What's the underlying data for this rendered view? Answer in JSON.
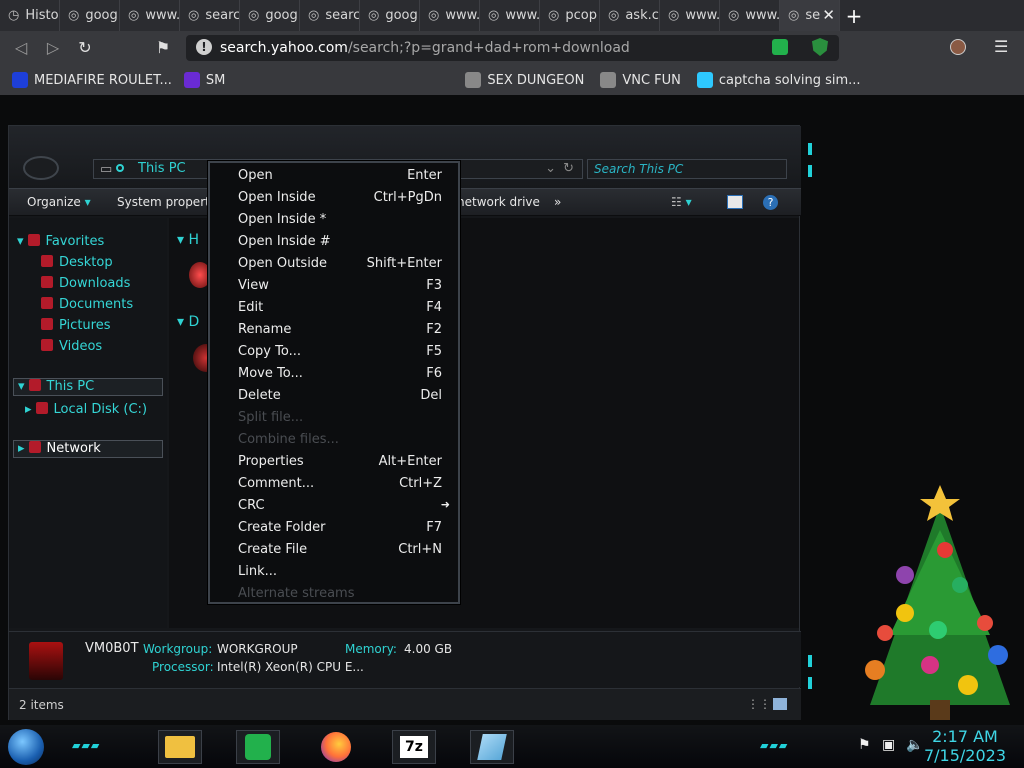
{
  "browser": {
    "tabs": [
      {
        "label": "Histo",
        "icon": "history-icon"
      },
      {
        "label": "goog",
        "icon": "globe-icon"
      },
      {
        "label": "www.",
        "icon": "globe-icon"
      },
      {
        "label": "searc",
        "icon": "globe-icon"
      },
      {
        "label": "goog",
        "icon": "globe-icon"
      },
      {
        "label": "searc",
        "icon": "globe-icon"
      },
      {
        "label": "goog",
        "icon": "globe-icon"
      },
      {
        "label": "www.",
        "icon": "globe-icon"
      },
      {
        "label": "www.",
        "icon": "globe-icon"
      },
      {
        "label": "pcop",
        "icon": "globe-icon"
      },
      {
        "label": "ask.c",
        "icon": "globe-icon"
      },
      {
        "label": "www.",
        "icon": "globe-icon"
      },
      {
        "label": "www.",
        "icon": "globe-icon"
      },
      {
        "label": "se",
        "icon": "globe-icon",
        "active": true
      }
    ],
    "new_tab": "+",
    "close_tab": "✕",
    "url_host": "search.yahoo.com",
    "url_path": "/search;?p=grand+dad+rom+download",
    "bookmarks": [
      {
        "label": "MEDIAFIRE ROULET...",
        "color": "#1e3fd8"
      },
      {
        "label": "SM",
        "color": "#6a2bd3"
      },
      {
        "label": "SEX DUNGEON",
        "color": "#888888"
      },
      {
        "label": "VNC FUN",
        "color": "#888888"
      },
      {
        "label": "captcha solving sim...",
        "color": "#2ec9ff"
      }
    ]
  },
  "explorer": {
    "address": "This PC",
    "search_placeholder": "Search This PC",
    "commands": {
      "organize": "Organize",
      "system_properties": "System properties",
      "map_network": "network drive",
      "more": "»"
    },
    "nav": {
      "favorites": "Favorites",
      "desktop": "Desktop",
      "downloads": "Downloads",
      "documents": "Documents",
      "pictures": "Pictures",
      "videos": "Videos",
      "this_pc": "This PC",
      "local_disk": "Local Disk (C:)",
      "network": "Network"
    },
    "content": {
      "group1_initial": "H",
      "group2_initial": "D"
    },
    "details": {
      "computer_name": "VM0B0T",
      "workgroup_label": "Workgroup:",
      "workgroup_value": "WORKGROUP",
      "memory_label": "Memory:",
      "memory_value": "4.00 GB",
      "processor_label": "Processor:",
      "processor_value": "Intel(R) Xeon(R) CPU E..."
    },
    "status": "2 items"
  },
  "context_menu": {
    "items": [
      {
        "label": "Open",
        "shortcut": "Enter",
        "enabled": true
      },
      {
        "label": "Open Inside",
        "shortcut": "Ctrl+PgDn",
        "enabled": true
      },
      {
        "label": "Open Inside *",
        "shortcut": "",
        "enabled": true
      },
      {
        "label": "Open Inside #",
        "shortcut": "",
        "enabled": true
      },
      {
        "label": "Open Outside",
        "shortcut": "Shift+Enter",
        "enabled": true
      },
      {
        "label": "View",
        "shortcut": "F3",
        "enabled": true
      },
      {
        "label": "Edit",
        "shortcut": "F4",
        "enabled": true
      },
      {
        "label": "Rename",
        "shortcut": "F2",
        "enabled": true
      },
      {
        "label": "Copy To...",
        "shortcut": "F5",
        "enabled": true
      },
      {
        "label": "Move To...",
        "shortcut": "F6",
        "enabled": true
      },
      {
        "label": "Delete",
        "shortcut": "Del",
        "enabled": true
      },
      {
        "label": "Split file...",
        "shortcut": "",
        "enabled": false
      },
      {
        "label": "Combine files...",
        "shortcut": "",
        "enabled": false
      },
      {
        "label": "Properties",
        "shortcut": "Alt+Enter",
        "enabled": true
      },
      {
        "label": "Comment...",
        "shortcut": "Ctrl+Z",
        "enabled": true
      },
      {
        "label": "CRC",
        "shortcut": "➜",
        "enabled": true
      },
      {
        "label": "Create Folder",
        "shortcut": "F7",
        "enabled": true
      },
      {
        "label": "Create File",
        "shortcut": "Ctrl+N",
        "enabled": true
      },
      {
        "label": "Link...",
        "shortcut": "",
        "enabled": true
      },
      {
        "label": "Alternate streams",
        "shortcut": "",
        "enabled": false
      }
    ]
  },
  "taskbar": {
    "apps": [
      {
        "name": "file-explorer"
      },
      {
        "name": "sheets"
      },
      {
        "name": "firefox"
      },
      {
        "name": "7zip",
        "label": "7z"
      },
      {
        "name": "notepad"
      }
    ],
    "time": "2:17 AM",
    "date": "7/15/2023"
  },
  "colors": {
    "accent": "#21d1d9",
    "menu_bg": "#0c0d0f",
    "browser_chrome": "#38393d"
  }
}
